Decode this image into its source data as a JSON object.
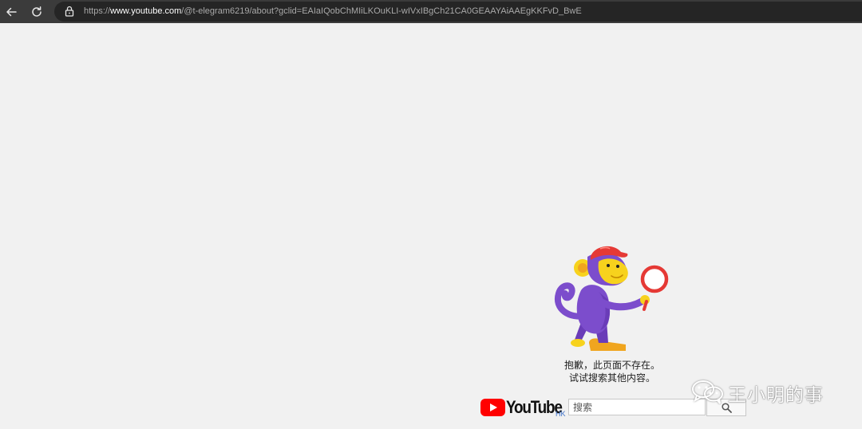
{
  "browser": {
    "url_scheme": "https://",
    "url_host": "www.youtube.com",
    "url_path": "/@t-elegram6219/about?gclid=EAIaIQobChMIiLKOuKLI-wIVxIBgCh21CA0GEAAYAiAAEgKKFvD_BwE",
    "back_icon": "arrow-left-icon",
    "reload_icon": "reload-icon",
    "lock_icon": "lock-icon"
  },
  "error": {
    "line1": "抱歉，此页面不存在。",
    "line2": "试试搜索其他内容。",
    "illustration": "monkey-magnifier-illustration"
  },
  "search": {
    "logo_text": "YouTube",
    "region": "HK",
    "placeholder": "搜索",
    "button_icon": "search-icon"
  },
  "watermark": {
    "text": "王小明的事",
    "icon": "wechat-icon"
  },
  "colors": {
    "page_bg": "#f1f1f1",
    "topbar_bg": "#3b3b3b",
    "urlbar_bg": "#252525",
    "youtube_red": "#ff0000",
    "monkey_purple": "#7c4dcc",
    "monkey_yellow": "#f7d21d",
    "cap_red": "#e53935"
  }
}
